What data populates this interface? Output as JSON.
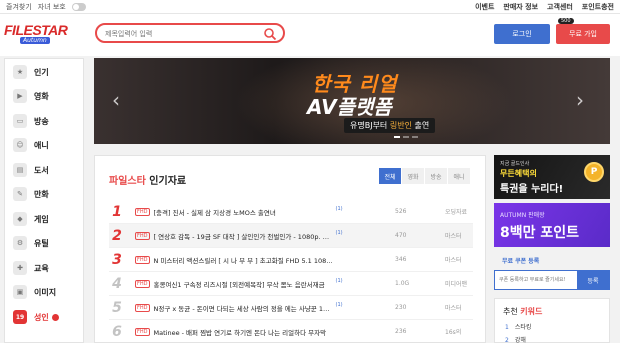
{
  "topbar": {
    "left": [
      "즐겨찾기",
      "자녀 보호"
    ],
    "right": [
      "이벤트",
      "판매자 정보",
      "고객센터",
      "포인트충전"
    ]
  },
  "header": {
    "logo_text": "FILESTAR",
    "logo_sub": "Autumn",
    "search_placeholder": "제목입력어 입력",
    "login_label": "로그인",
    "join_label": "무료 가입",
    "join_bonus": "500",
    "search_icon": "search-icon"
  },
  "sidebar": {
    "items": [
      {
        "label": "인기",
        "icon": "popular-icon"
      },
      {
        "label": "영화",
        "icon": "movie-icon"
      },
      {
        "label": "방송",
        "icon": "broadcast-icon"
      },
      {
        "label": "애니",
        "icon": "anime-icon"
      },
      {
        "label": "도서",
        "icon": "book-icon"
      },
      {
        "label": "만화",
        "icon": "comic-icon"
      },
      {
        "label": "게임",
        "icon": "game-icon"
      },
      {
        "label": "유틸",
        "icon": "utility-icon"
      },
      {
        "label": "교육",
        "icon": "education-icon"
      },
      {
        "label": "이미지",
        "icon": "image-icon"
      },
      {
        "label": "성인",
        "icon": "adult-icon",
        "badge": "19"
      }
    ]
  },
  "banner": {
    "line1": "한국 리얼",
    "line2": "AV플랫폼",
    "line3_a": "유명BJ부터",
    "line3_b": "링반인",
    "line3_c": "출연"
  },
  "popular": {
    "brand": "파일스타",
    "title": "인기자료",
    "tabs": [
      "전체",
      "영화",
      "방송",
      "애니"
    ],
    "active_tab": 0,
    "rows": [
      {
        "rank": "1",
        "tag": "FHD",
        "title": "[충격] 진서 - 실제 삼 지상경 노MO스 출연녀",
        "size": "526",
        "seller": "오딩자료"
      },
      {
        "rank": "2",
        "tag": "FHD",
        "title": "[ 연상호 감독 - 19금 SF 대작 ] 살인인가 천벌인가 - 1080p. 최…",
        "size": "470",
        "seller": "마스터"
      },
      {
        "rank": "3",
        "tag": "FHD",
        "title": "N 미스터리 액션스릴러 [ 시 나 부 부 ] 초고화질 FHD 5.1 1080p",
        "size": "346",
        "seller": "마스터"
      },
      {
        "rank": "4",
        "tag": "FHD",
        "title": "홍콩여신1 구속정 리즈시절 [외전예목작] 무삭 몸노 음란서재금",
        "size": "1.0G",
        "seller": "미디어맨"
      },
      {
        "rank": "5",
        "tag": "FHD",
        "title": "N정구 x 동균 - 돈이면 다되는 세상 사람의 정을 에는 사냥꾼 108…",
        "size": "230",
        "seller": "마스터"
      },
      {
        "rank": "6",
        "tag": "FHD",
        "title": "Matinee - 배퍼 찜밥 연기로 하기엔 돈다 나는 리얼하다 무자막",
        "size": "236",
        "seller": "16s의"
      }
    ]
  },
  "ads": {
    "ad1_a": "지금 골드인사",
    "ad1_b": "무든혜택의",
    "ad1_c": "특권을 누리다!",
    "ad1_coin": "P",
    "ad2_a": "AUTUMN 판매왕",
    "ad2_b": "8백만 포인트"
  },
  "coupon": {
    "title": "무료 쿠폰 등록",
    "placeholder": "쿠폰 등록하고 무료로 즐기세요!",
    "button": "등록"
  },
  "keywords": {
    "title_a": "추천",
    "title_b": "키워드",
    "items": [
      "스타킹",
      "강해"
    ]
  }
}
